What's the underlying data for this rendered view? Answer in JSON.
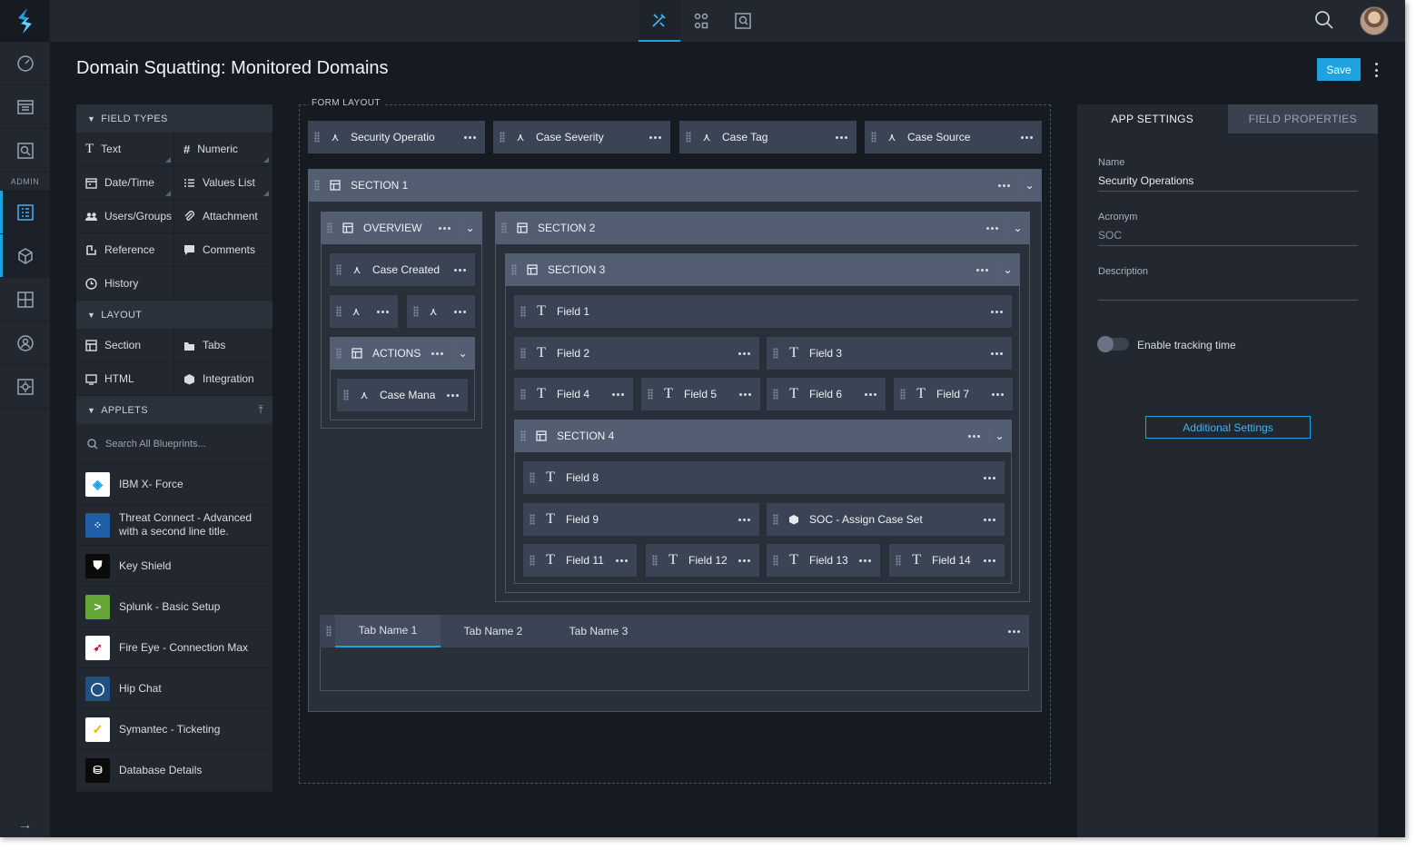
{
  "app": {
    "title": "Domain Squatting: Monitored Domains",
    "save_label": "Save",
    "admin_label": "ADMIN"
  },
  "colors": {
    "accent": "#1fa3e0",
    "background": "#161a21",
    "panel": "#232830",
    "card": "#3b4454",
    "section_header": "#535e72"
  },
  "rail": {
    "items": [
      "dashboard-icon",
      "workspace-icon",
      "search-report-icon",
      "form-builder-icon",
      "integrations-icon",
      "layouts-icon",
      "users-icon",
      "settings-icon"
    ],
    "collapse_icon": "arrow-right-icon"
  },
  "topbar": {
    "icons": [
      "designer-icon",
      "workflow-icon",
      "report-icon"
    ],
    "search_icon": "search-icon",
    "avatar": "user-avatar"
  },
  "palette": {
    "field_types_title": "FIELD TYPES",
    "field_types": [
      {
        "label": "Text",
        "icon": "text-icon"
      },
      {
        "label": "Numeric",
        "icon": "hash-icon"
      },
      {
        "label": "Date/Time",
        "icon": "calendar-icon"
      },
      {
        "label": "Values List",
        "icon": "list-icon"
      },
      {
        "label": "Users/Groups",
        "icon": "users-icon"
      },
      {
        "label": "Attachment",
        "icon": "paperclip-icon"
      },
      {
        "label": "Reference",
        "icon": "reference-icon"
      },
      {
        "label": "Comments",
        "icon": "comment-icon"
      },
      {
        "label": "History",
        "icon": "clock-icon"
      }
    ],
    "layout_title": "LAYOUT",
    "layout": [
      {
        "label": "Section",
        "icon": "grid-icon"
      },
      {
        "label": "Tabs",
        "icon": "tabs-icon"
      },
      {
        "label": "HTML",
        "icon": "html-icon"
      },
      {
        "label": "Integration",
        "icon": "cube-icon"
      }
    ],
    "applets_title": "APPLETS",
    "search_placeholder": "Search All Blueprints...",
    "applets": [
      {
        "label": "IBM X- Force",
        "icon": "ibm-xforce-logo"
      },
      {
        "label": "Threat Connect - Advanced with a second line title.",
        "icon": "threatconnect-logo"
      },
      {
        "label": "Key Shield",
        "icon": "shield-logo"
      },
      {
        "label": "Splunk - Basic Setup",
        "icon": "splunk-logo"
      },
      {
        "label": "Fire Eye - Connection Max",
        "icon": "fireeye-logo"
      },
      {
        "label": "Hip Chat",
        "icon": "hipchat-logo"
      },
      {
        "label": "Symantec - Ticketing",
        "icon": "symantec-logo"
      },
      {
        "label": "Database Details",
        "icon": "database-logo"
      }
    ]
  },
  "form": {
    "label": "FORM LAYOUT",
    "top_fields": [
      "Security Operatio",
      "Case Severity",
      "Case Tag",
      "Case Source"
    ],
    "section1": "SECTION 1",
    "overview": "OVERVIEW",
    "case_created": "Case Created",
    "actions": "ACTIONS",
    "case_mana": "Case Mana",
    "section2": "SECTION 2",
    "section3": "SECTION 3",
    "section4": "SECTION 4",
    "fields": {
      "f1": "Field 1",
      "f2": "Field 2",
      "f3": "Field 3",
      "f4": "Field 4",
      "f5": "Field 5",
      "f6": "Field 6",
      "f7": "Field 7",
      "f8": "Field 8",
      "f9": "Field 9",
      "soc": "SOC - Assign Case Set",
      "f11": "Field 11",
      "f12": "Field 12",
      "f13": "Field 13",
      "f14": "Field 14"
    },
    "tabs": [
      "Tab Name 1",
      "Tab Name 2",
      "Tab Name 3"
    ]
  },
  "props": {
    "tab_app": "APP SETTINGS",
    "tab_field": "FIELD PROPERTIES",
    "name_label": "Name",
    "name_value": "Security Operations",
    "acronym_label": "Acronym",
    "acronym_value": "SOC",
    "description_label": "Description",
    "description_value": "",
    "toggle_label": "Enable tracking time",
    "toggle_on": false,
    "additional_label": "Additional Settings"
  }
}
